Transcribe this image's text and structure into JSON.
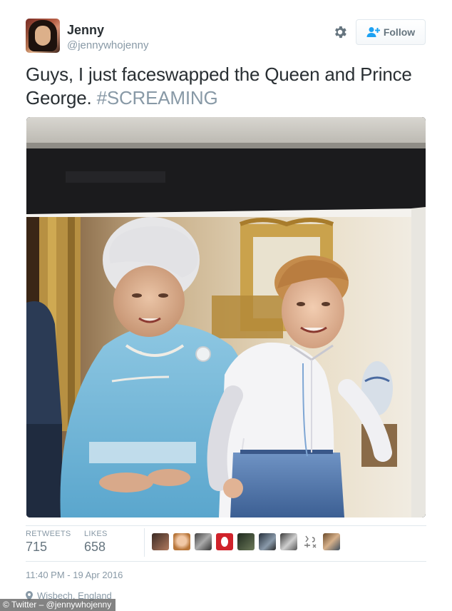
{
  "author": {
    "name": "Jenny",
    "handle": "@jennywhojenny"
  },
  "actions": {
    "follow_label": "Follow",
    "settings_icon": "gear-icon",
    "follow_icon": "add-user-icon"
  },
  "tweet": {
    "text": "Guys, I just faceswapped the Queen and Prince George.",
    "hashtag": "#SCREAMING"
  },
  "stats": {
    "retweets_label": "RETWEETS",
    "retweets_value": "715",
    "likes_label": "LIKES",
    "likes_value": "658"
  },
  "likers_count_shown": 9,
  "timestamp": "11:40 PM - 19 Apr 2016",
  "location": "Wisbech, England",
  "credit": "© Twitter – @jennywhojenny",
  "colors": {
    "text": "#292f33",
    "muted": "#8899a6",
    "hashtag": "#8899a6",
    "border": "#e1e8ed",
    "follow_text": "#66757f"
  }
}
